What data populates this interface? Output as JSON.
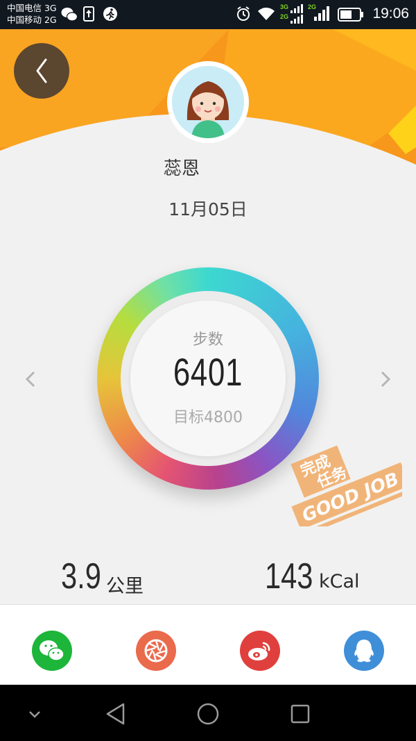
{
  "status_bar": {
    "carrier_1": "中国电信 3G",
    "carrier_2": "中国移动 2G",
    "net_3g": "3G",
    "net_2g_a": "2G",
    "net_2g_b": "2G",
    "time": "19:06",
    "icons": [
      "wechat-icon",
      "upload-icon",
      "runner-icon",
      "alarm-icon",
      "wifi-icon",
      "signal-icon",
      "battery-icon"
    ]
  },
  "header": {
    "user_name": "蕊恩",
    "date": "11月05日"
  },
  "ring": {
    "steps_label": "步数",
    "steps_value": "6401",
    "goal_label": "目标4800"
  },
  "stamp": {
    "line1": "完成",
    "line2": "任务",
    "line3": "GOOD JOB"
  },
  "stats": {
    "distance_value": "3.9",
    "distance_unit": "公里",
    "calories_value": "143",
    "calories_unit": "kCal"
  },
  "share": {
    "buttons": [
      "wechat-icon",
      "moments-icon",
      "weibo-icon",
      "qq-icon"
    ],
    "colors": [
      "#1db53a",
      "#ea6a4c",
      "#e0403d",
      "#3f8fd8"
    ]
  },
  "colors": {
    "header_orange": "#f9a21e",
    "back_button": "#5b4630"
  }
}
